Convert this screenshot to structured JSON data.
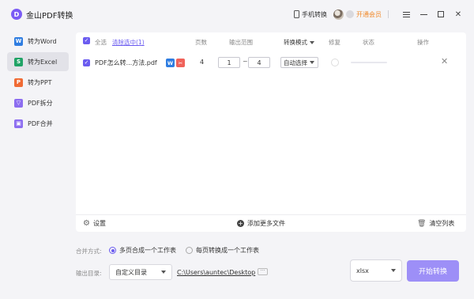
{
  "titlebar": {
    "title": "金山PDF转换",
    "logo_letter": "D",
    "phone_label": "手机转换",
    "vip_label": "开通会员"
  },
  "sidebar": {
    "items": [
      {
        "label": "转为Word",
        "icon": "W",
        "color": "#2f7de1"
      },
      {
        "label": "转为Excel",
        "icon": "S",
        "color": "#21a366"
      },
      {
        "label": "转为PPT",
        "icon": "P",
        "color": "#f06b35"
      },
      {
        "label": "PDF拆分",
        "icon": "▽",
        "color": "#8c6df0"
      },
      {
        "label": "PDF合并",
        "icon": "▣",
        "color": "#8c6df0"
      }
    ]
  },
  "table": {
    "select_all": "全选",
    "clear_selection": "清除选中(1)",
    "col_pages": "页数",
    "col_range": "输出范围",
    "col_mode": "转换模式",
    "col_repair": "修复",
    "col_status": "状态",
    "col_action": "操作",
    "rows": [
      {
        "name": "PDF怎么转...方法.pdf",
        "badge_w": "W",
        "badge_p": "✂",
        "pages": "4",
        "from": "1",
        "dash": "~",
        "to": "4",
        "mode": "自动选择"
      }
    ]
  },
  "footer": {
    "settings": "设置",
    "add_files": "添加更多文件",
    "clear_list": "清空列表"
  },
  "options": {
    "merge_label": "合并方式:",
    "merge_opt1": "多页合成一个工作表",
    "merge_opt2": "每页转换成一个工作表",
    "output_label": "输出目录:",
    "output_select": "自定义目录",
    "output_path": "C:\\Users\\auntec\\Desktop",
    "format": "xlsx",
    "start": "开始转换"
  },
  "colors": {
    "accent": "#6b5cf0",
    "vip": "#f18a2b"
  }
}
